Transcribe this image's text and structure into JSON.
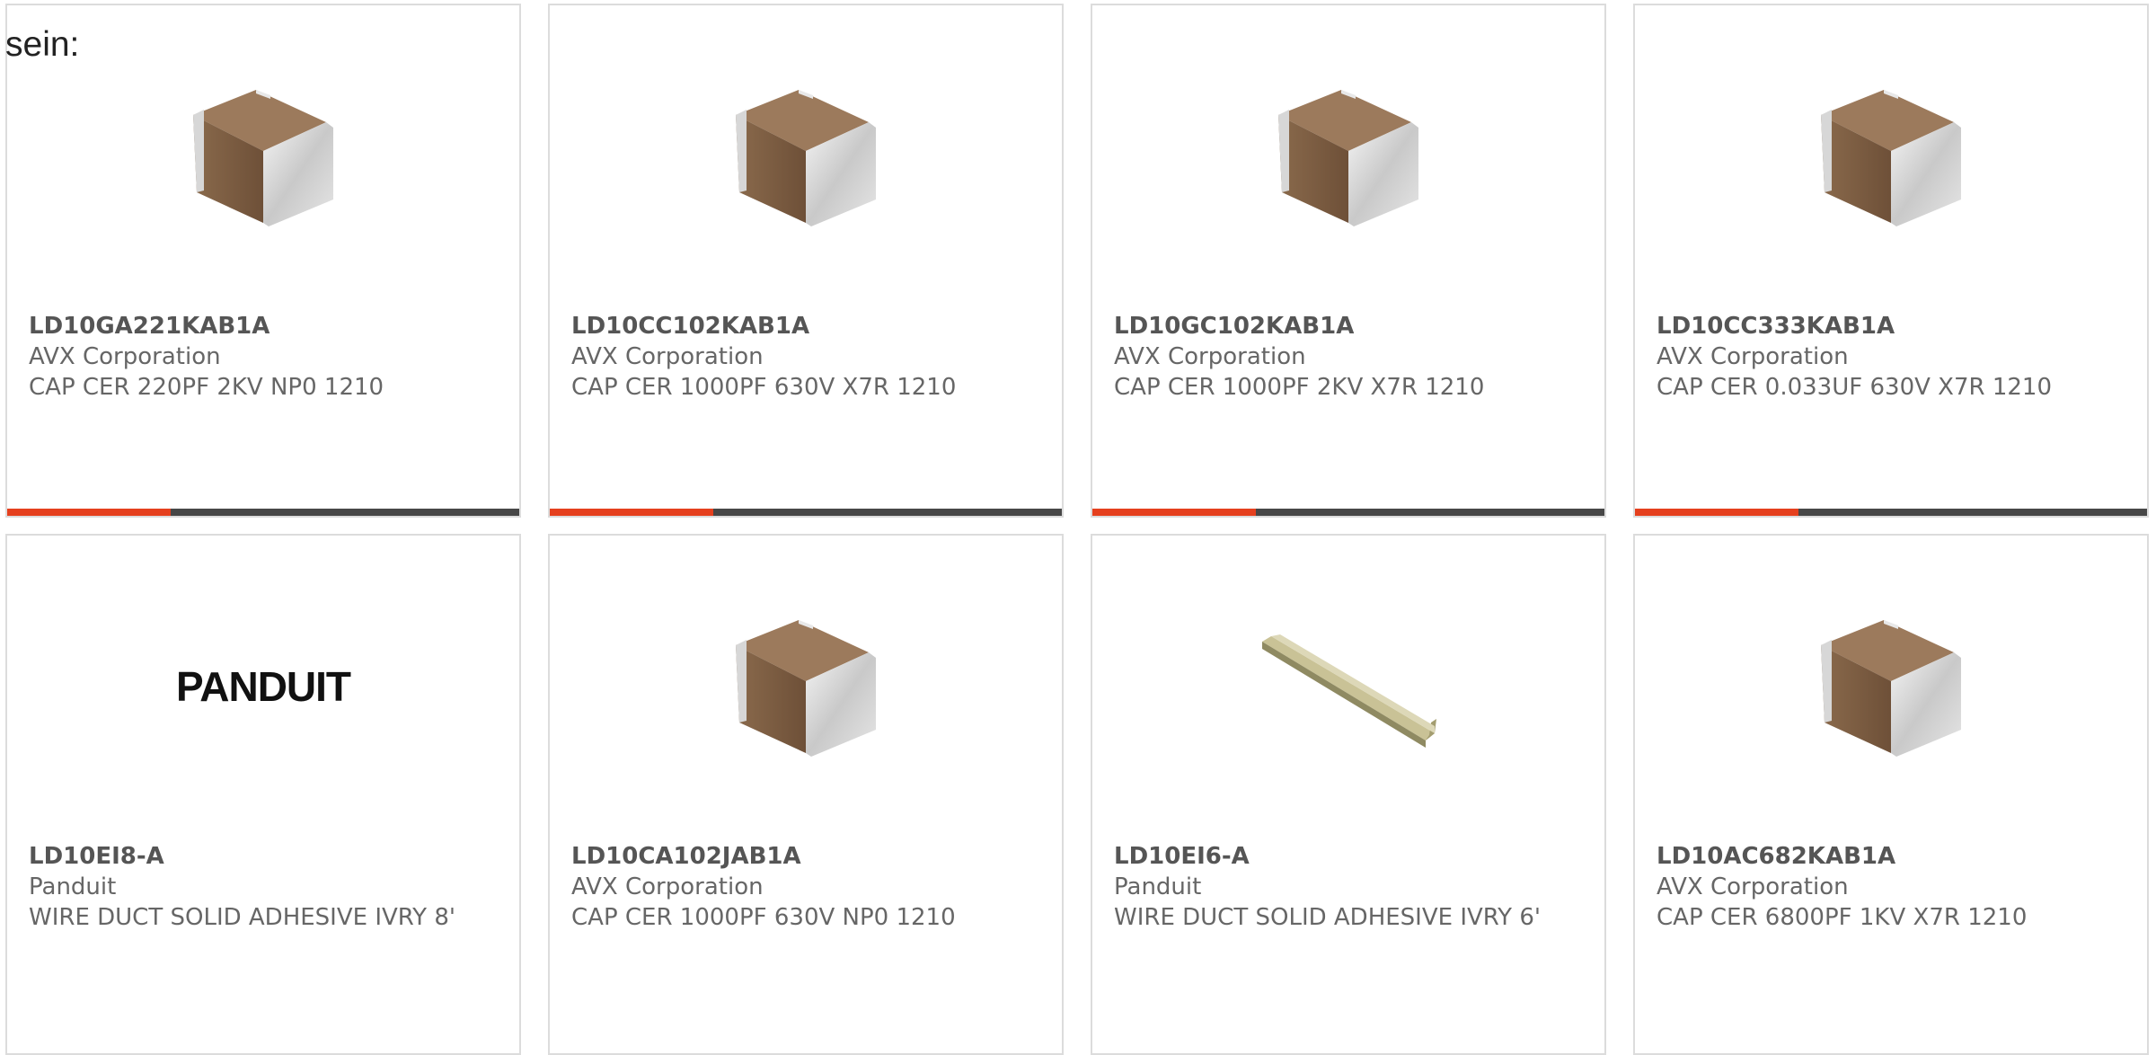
{
  "intro_text": "sein:",
  "colors": {
    "accent": "#e5401e",
    "bar_dark": "#474747",
    "text": "#666666",
    "card_border": "#dcdcdc"
  },
  "products": [
    {
      "part_number": "LD10GA221KAB1A",
      "manufacturer": "AVX Corporation",
      "description": "CAP CER 220PF 2KV NP0 1210",
      "image": "ceramic-capacitor-chip"
    },
    {
      "part_number": "LD10CC102KAB1A",
      "manufacturer": "AVX Corporation",
      "description": "CAP CER 1000PF 630V X7R 1210",
      "image": "ceramic-capacitor-chip"
    },
    {
      "part_number": "LD10GC102KAB1A",
      "manufacturer": "AVX Corporation",
      "description": "CAP CER 1000PF 2KV X7R 1210",
      "image": "ceramic-capacitor-chip"
    },
    {
      "part_number": "LD10CC333KAB1A",
      "manufacturer": "AVX Corporation",
      "description": "CAP CER 0.033UF 630V X7R 1210",
      "image": "ceramic-capacitor-chip"
    },
    {
      "part_number": "LD10EI8-A",
      "manufacturer": "Panduit",
      "description": "WIRE DUCT SOLID ADHESIVE IVRY 8'",
      "image": "panduit-logo",
      "logo_text": "PANDUIT"
    },
    {
      "part_number": "LD10CA102JAB1A",
      "manufacturer": "AVX Corporation",
      "description": "CAP CER 1000PF 630V NP0 1210",
      "image": "ceramic-capacitor-chip"
    },
    {
      "part_number": "LD10EI6-A",
      "manufacturer": "Panduit",
      "description": "WIRE DUCT SOLID ADHESIVE IVRY 6'",
      "image": "wire-duct"
    },
    {
      "part_number": "LD10AC682KAB1A",
      "manufacturer": "AVX Corporation",
      "description": "CAP CER 6800PF 1KV X7R 1210",
      "image": "ceramic-capacitor-chip"
    }
  ]
}
